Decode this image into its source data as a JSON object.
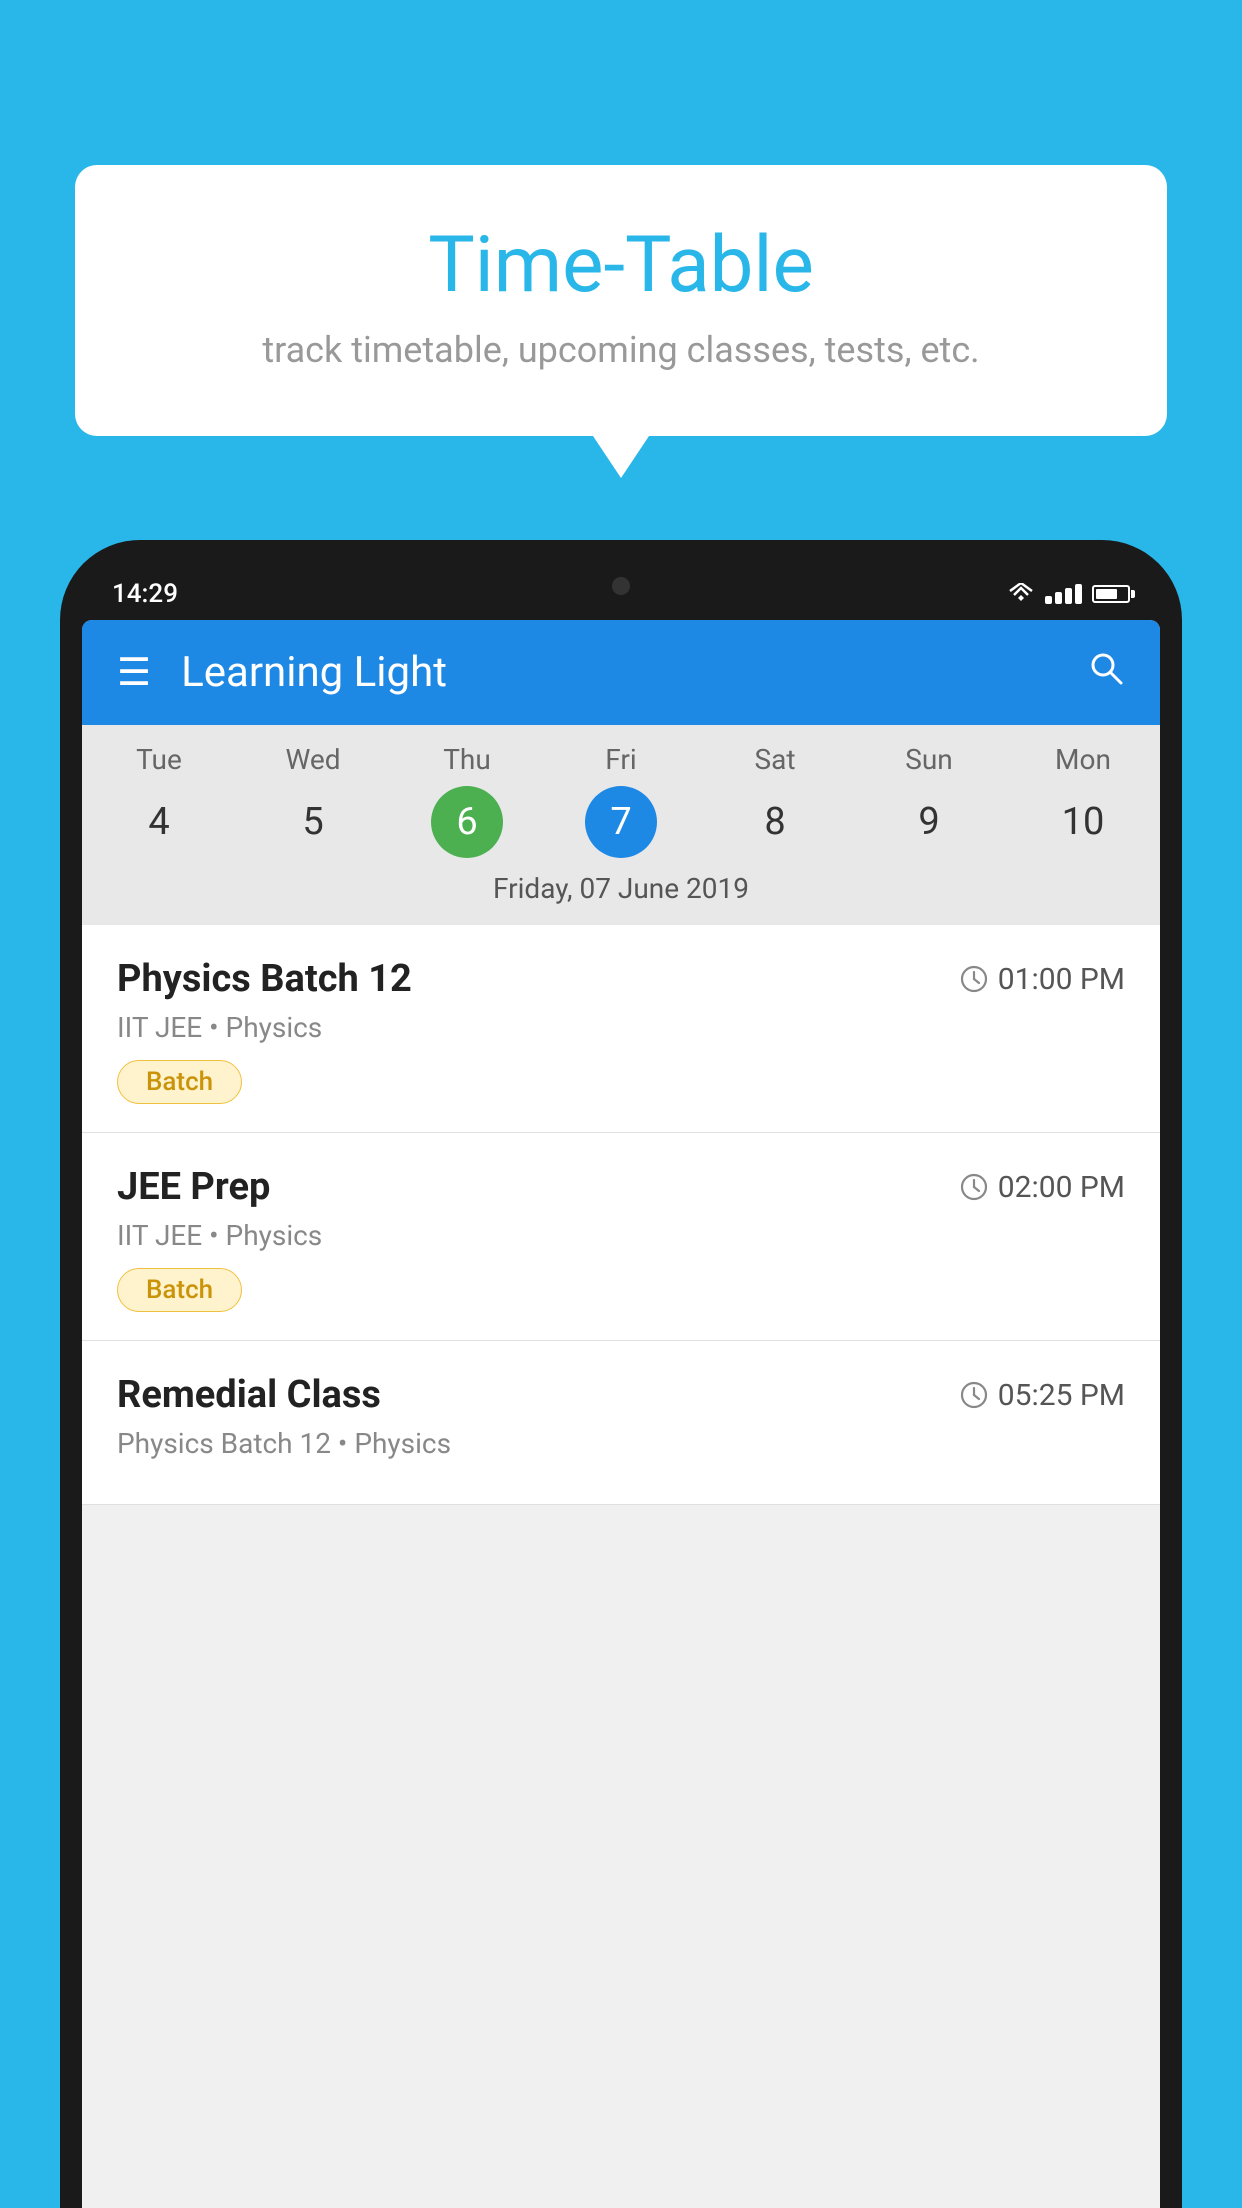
{
  "background": {
    "color": "#29B6E8"
  },
  "speech_bubble": {
    "title": "Time-Table",
    "subtitle": "track timetable, upcoming classes, tests, etc."
  },
  "phone": {
    "status_bar": {
      "time": "14:29"
    },
    "app_bar": {
      "title": "Learning Light",
      "hamburger_label": "☰",
      "search_label": "🔍"
    },
    "calendar": {
      "days_of_week": [
        "Tue",
        "Wed",
        "Thu",
        "Fri",
        "Sat",
        "Sun",
        "Mon"
      ],
      "dates": [
        "4",
        "5",
        "6",
        "7",
        "8",
        "9",
        "10"
      ],
      "today_index": 2,
      "selected_index": 3,
      "selected_date_label": "Friday, 07 June 2019"
    },
    "schedule": [
      {
        "title": "Physics Batch 12",
        "time": "01:00 PM",
        "subtitle": "IIT JEE • Physics",
        "badge": "Batch"
      },
      {
        "title": "JEE Prep",
        "time": "02:00 PM",
        "subtitle": "IIT JEE • Physics",
        "badge": "Batch"
      },
      {
        "title": "Remedial Class",
        "time": "05:25 PM",
        "subtitle": "Physics Batch 12 • Physics",
        "badge": null
      }
    ]
  }
}
